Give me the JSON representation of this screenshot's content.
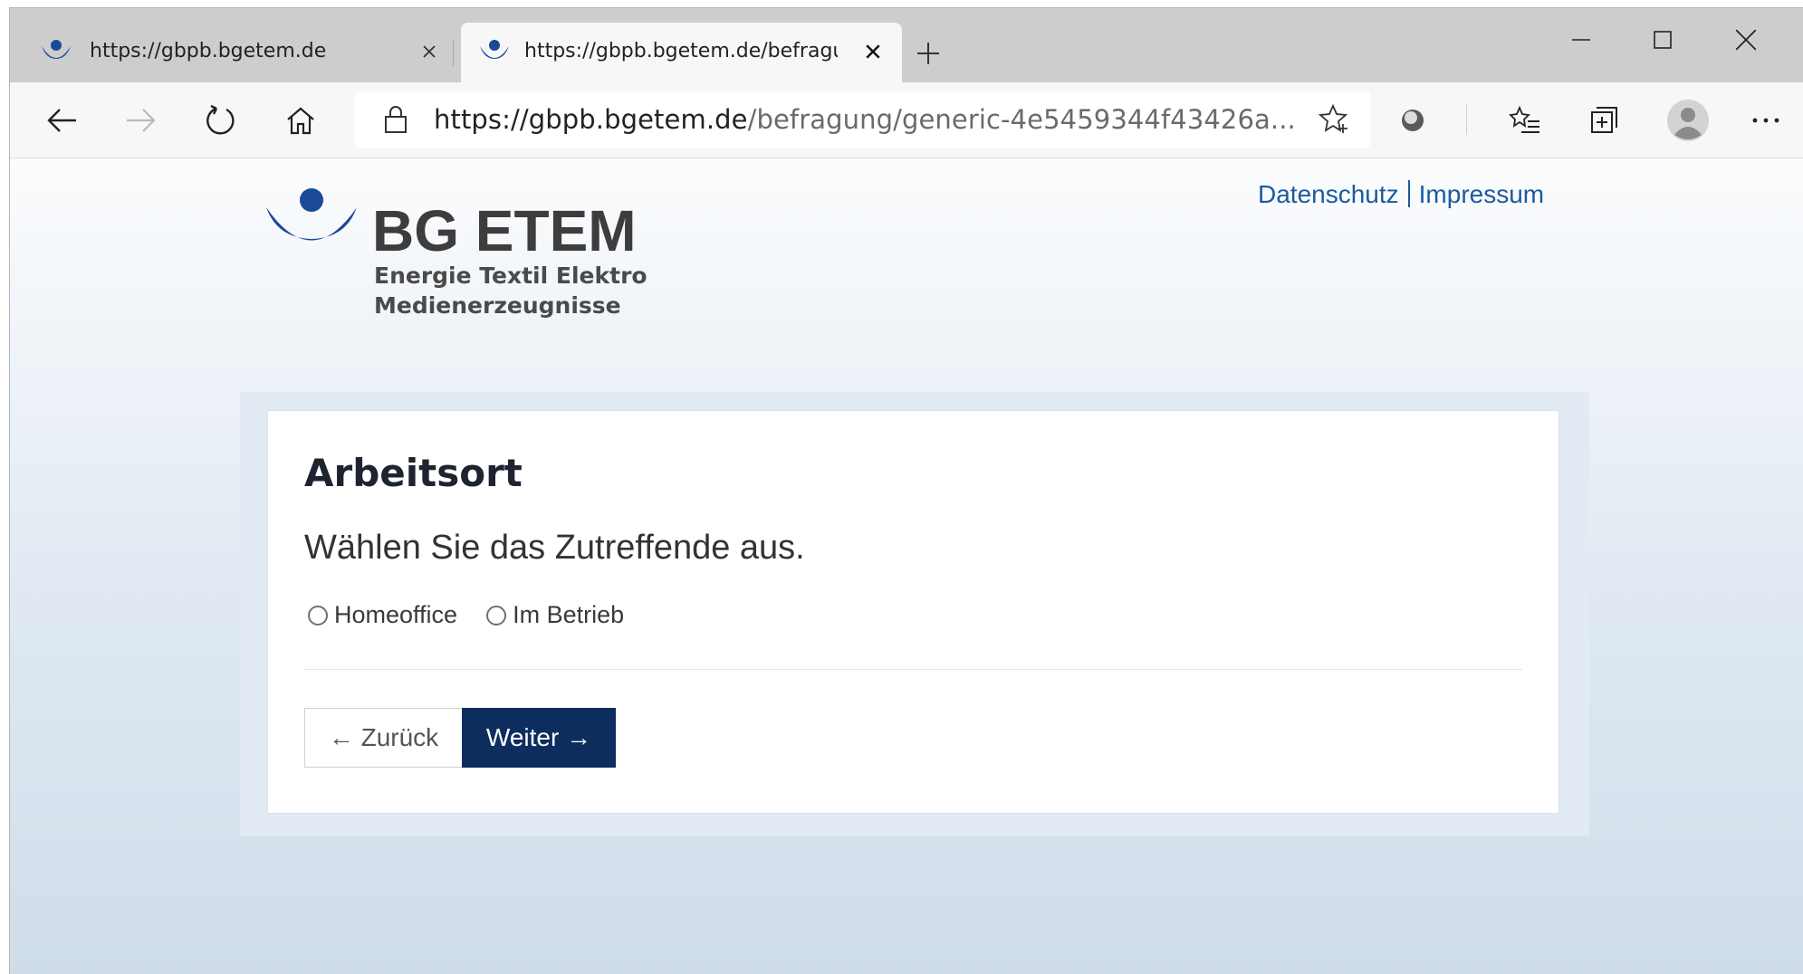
{
  "browser": {
    "tabs": [
      {
        "title": "https://gbpb.bgetem.de",
        "active": false
      },
      {
        "title": "https://gbpb.bgetem.de/befragu",
        "active": true
      }
    ],
    "address": {
      "host": "https://gbpb.bgetem.de",
      "path": "/befragung/generic-4e5459344f43426a..."
    },
    "icons": {
      "back": "arrow-left-icon",
      "forward": "arrow-right-icon",
      "reload": "reload-icon",
      "home": "home-icon",
      "lock": "lock-icon",
      "favorite": "star-add-icon",
      "extension": "extension-icon",
      "favorites": "favorites-list-icon",
      "collections": "collections-icon",
      "profile": "profile-avatar-icon",
      "menu": "more-dots-icon"
    }
  },
  "site": {
    "logo": {
      "name": "BG ETEM",
      "line1": "Energie Textil Elektro",
      "line2": "Medienerzeugnisse"
    },
    "links": {
      "privacy": "Datenschutz",
      "imprint": "Impressum"
    },
    "colors": {
      "brand_blue": "#1a4a97",
      "button_dark": "#0d2d5e",
      "link": "#1c5aa0"
    }
  },
  "form": {
    "heading": "Arbeitsort",
    "prompt": "Wählen Sie das Zutreffende aus.",
    "options": [
      "Homeoffice",
      "Im Betrieb"
    ],
    "selected": null,
    "back_label": "← Zurück",
    "next_label": "Weiter →"
  }
}
